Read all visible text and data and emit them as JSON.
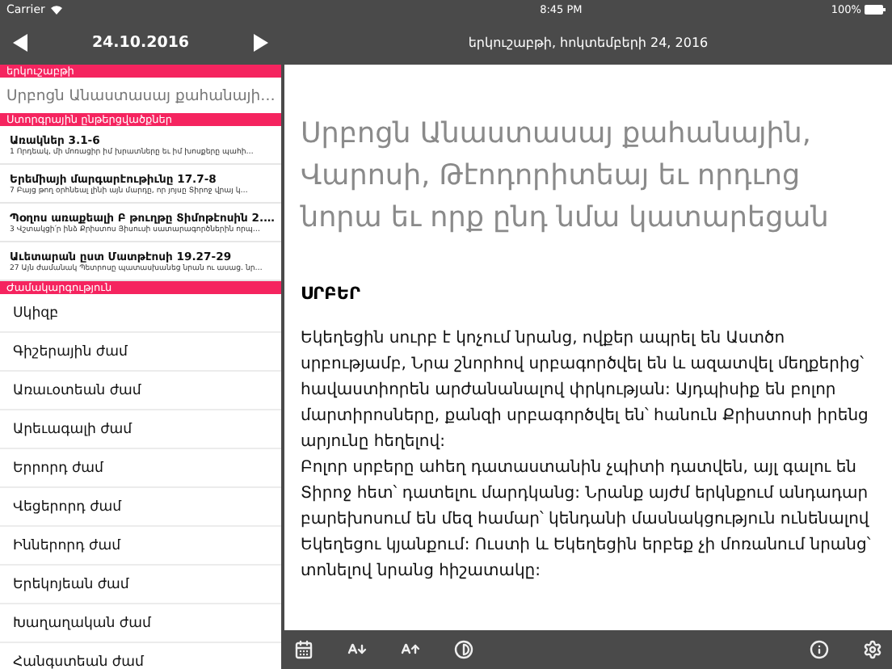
{
  "status_bar": {
    "carrier": "Carrier",
    "time": "8:45 PM",
    "battery": "100%"
  },
  "sidebar": {
    "date": "24.10.2016",
    "day_header": "երկուշաբթի",
    "feast": "Սրբոցն Անաստասայ քահանայի…",
    "readings_header": "Ստորգրային ընթերցվածքներ",
    "readings": [
      {
        "title": "Առակներ 3.1-6",
        "excerpt": "1 Որդեակ, մի մոռացիր իմ խրատները եւ իմ խոսքերը պահի…"
      },
      {
        "title": "Երեմիայի մարգարէութիւնը 17.7-8",
        "excerpt": "7 Բայց թող օրհնեալ լինի այն մարդը, որ յոյսը Տիրոջ վրայ կ…"
      },
      {
        "title": "Պօղոս առաքեալի Բ թուղթը Տիմոթէոսին 2.…",
        "excerpt": "3 Վշտակցի՛ր ինձ Քրիստոս Յիսուսի սատարագործներին որպ…"
      },
      {
        "title": "Աւետարան ըստ Մատթէոսի 19.27-29",
        "excerpt": "27 Այն ժամանակ Պետրոսը պատասխանեց նրան ու ասաց. նր…"
      }
    ],
    "hours_header": "Ժամակարգություն",
    "hours": [
      "Սկիզբ",
      "Գիշերային ժամ",
      "Առաւօտեան ժամ",
      "Արեւագալի ժամ",
      "Երրորդ ժամ",
      "Վեցերորդ ժամ",
      "Իններորդ ժամ",
      "Երեկոյեան ժամ",
      "Խաղաղական ժամ",
      "Հանգստեան ժամ"
    ]
  },
  "main": {
    "title": "երկուշաբթի, հոկտեմբերի 24, 2016",
    "feast_title": "Սրբոցն Անաստասայ քահանային, Վարոսի, Թէոդորիտեայ եւ որդւոց նորա եւ որք ընդ նմա կատարեցան",
    "section": "ՍՐԲԵՐ",
    "paragraphs": [
      "Եկեղեցին սուրբ է կոչում նրանց, ովքեր ապրել են Աստծո սրբությամբ, Նրա շնորհով սրբագործվել են և ազատվել մեղքերից՝ հավաստիորեն արժանանալով փրկության: Այդպիսիք են բոլոր մարտիրոսները, քանզի սրբագործվել են՝ հանուն Քրիստոսի իրենց արյունը հեղելով:",
      "Բոլոր սրբերը ահեղ դատաստանին չպիտի դատվեն, այլ գալու են Տիրոջ հետ՝ դատելու մարդկանց: Նրանք այժմ երկնքում անդադար բարեխոսում են մեզ համար՝ կենդանի մասնակցություն ունենալով Եկեղեցու կյանքում: Ուստի և Եկեղեցին երբեք չի մոռանում նրանց՝ տոնելով նրանց հիշատակը:"
    ]
  },
  "toolbar": [
    {
      "kind": "calendar"
    },
    {
      "kind": "font-smaller"
    },
    {
      "kind": "font-larger"
    },
    {
      "kind": "contrast"
    },
    {
      "kind": "spacer"
    },
    {
      "kind": "info"
    },
    {
      "kind": "settings"
    }
  ]
}
